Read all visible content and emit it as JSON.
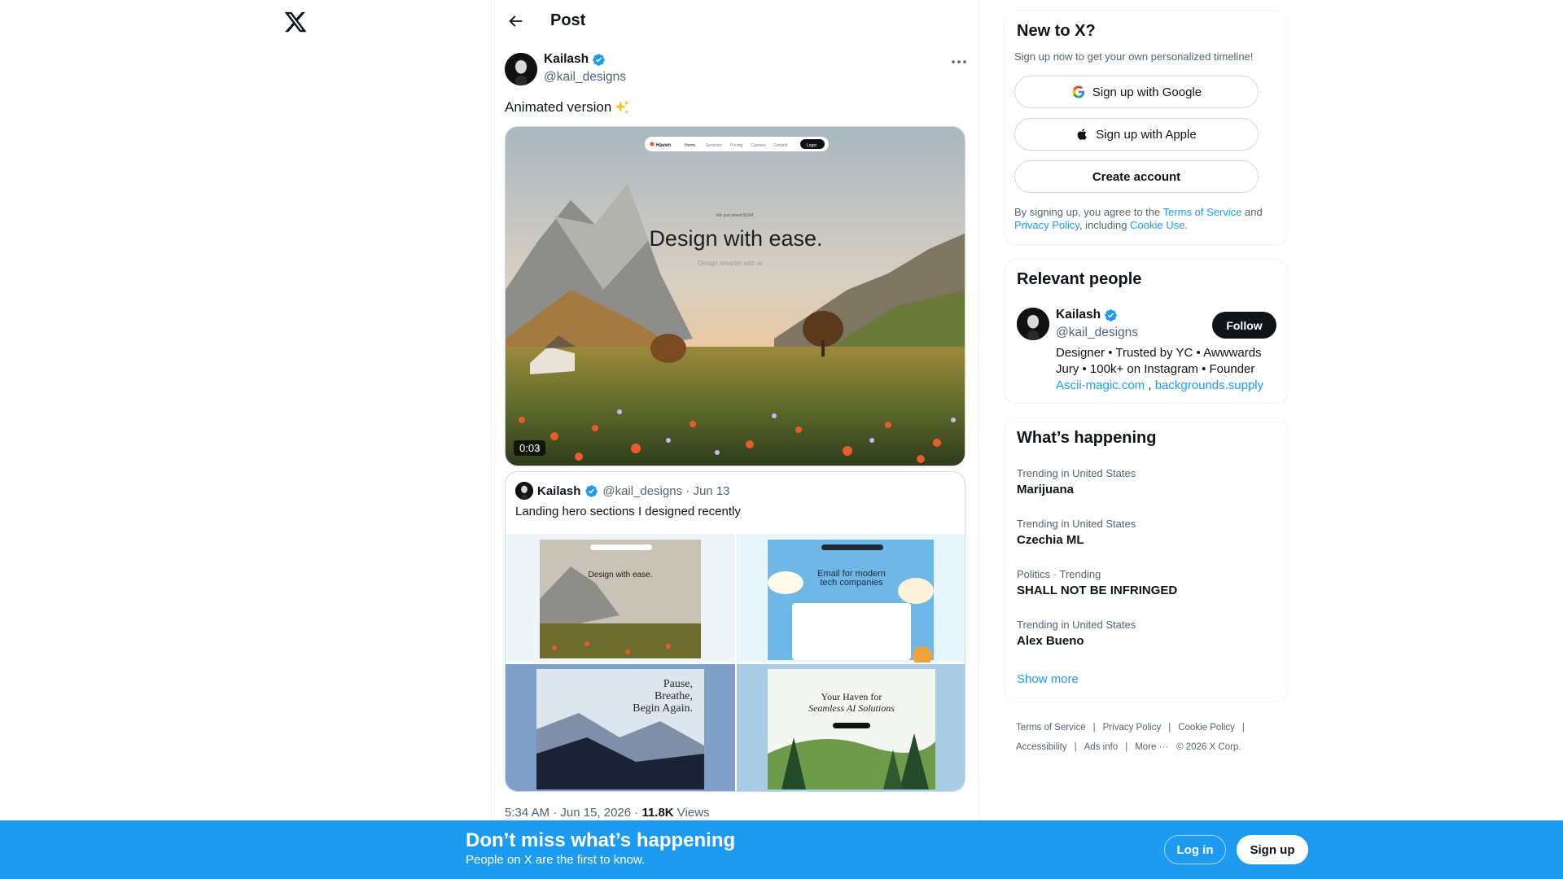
{
  "header": {
    "title": "Post"
  },
  "post": {
    "author_name": "Kailash",
    "author_handle": "@kail_designs",
    "text": "Animated version",
    "video_duration": "0:03",
    "media": {
      "nav_brand": "Haven",
      "nav_items": [
        "Home",
        "Services",
        "Pricing",
        "Careers",
        "Contact"
      ],
      "nav_cta": "Login",
      "pill": "We just raised $10M",
      "headline": "Design with ease.",
      "subline": "Design smarter with ai"
    },
    "timestamp": "5:34 AM · Jun 15, 2026 · ",
    "views_count": "11.8K",
    "views_label": " Views"
  },
  "quote": {
    "author_name": "Kailash",
    "meta": "@kail_designs · Jun 13",
    "text": "Landing hero sections I designed recently",
    "tiles": {
      "t1_headline": "Design with ease.",
      "t2_headline_1": "Email for modern",
      "t2_headline_2": "tech companies",
      "t3_line_1": "Pause,",
      "t3_line_2": "Breathe,",
      "t3_line_3": "Begin Again.",
      "t4_line_1": "Your Haven for",
      "t4_line_2": "Seamless AI Solutions"
    }
  },
  "signup_card": {
    "title": "New to X?",
    "subtitle": "Sign up now to get your own personalized timeline!",
    "google_label": "Sign up with Google",
    "apple_label": "Sign up with Apple",
    "create_label": "Create account",
    "terms_prefix": "By signing up, you agree to the ",
    "terms_link": "Terms of Service",
    "terms_and": " and ",
    "privacy_link": "Privacy Policy",
    "terms_including": ", including ",
    "cookie_link": "Cookie Use",
    "terms_end": "."
  },
  "relevant": {
    "title": "Relevant people",
    "name": "Kailash",
    "handle": "@kail_designs",
    "follow_label": "Follow",
    "bio": "Designer • Trusted by YC • Awwwards Jury • 100k+ on Instagram • Founder ",
    "link_1": "Ascii-magic.com",
    "bio_sep": " , ",
    "link_2": "backgrounds.supply"
  },
  "trends": {
    "title": "What’s happening",
    "items": [
      {
        "category": "Trending in United States",
        "name": "Marijuana"
      },
      {
        "category": "Trending in United States",
        "name": "Czechia ML"
      },
      {
        "category": "Politics · Trending",
        "name": "SHALL NOT BE INFRINGED"
      },
      {
        "category": "Trending in United States",
        "name": "Alex Bueno"
      }
    ],
    "show_more": "Show more"
  },
  "footer": {
    "terms": "Terms of Service",
    "privacy": "Privacy Policy",
    "cookie": "Cookie Policy",
    "accessibility": "Accessibility",
    "ads": "Ads info",
    "more": "More ···",
    "copyright": "© 2026 X Corp."
  },
  "banner": {
    "title": "Don’t miss what’s happening",
    "subtitle": "People on X are the first to know.",
    "login_label": "Log in",
    "signup_label": "Sign up"
  },
  "colors": {
    "accent": "#1d9bf0",
    "text": "#0f1419",
    "muted": "#536471"
  }
}
